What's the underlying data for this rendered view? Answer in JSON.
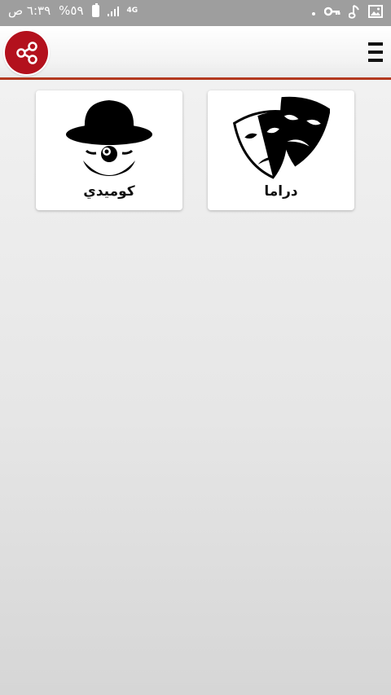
{
  "status_bar": {
    "time": "٦:٣٩ ص",
    "battery": "%٥٩",
    "network": "4G",
    "icons": [
      "image-icon",
      "music-note-icon",
      "key-icon",
      "notification-dot-icon"
    ]
  },
  "app_bar": {
    "share_icon": "share-icon",
    "menu_icon": "hamburger-menu-icon",
    "accent_color": "#b3391f",
    "share_color": "#b3111d"
  },
  "categories": [
    {
      "label": "كوميدي",
      "icon": "clown-icon"
    },
    {
      "label": "دراما",
      "icon": "theater-masks-icon"
    }
  ]
}
